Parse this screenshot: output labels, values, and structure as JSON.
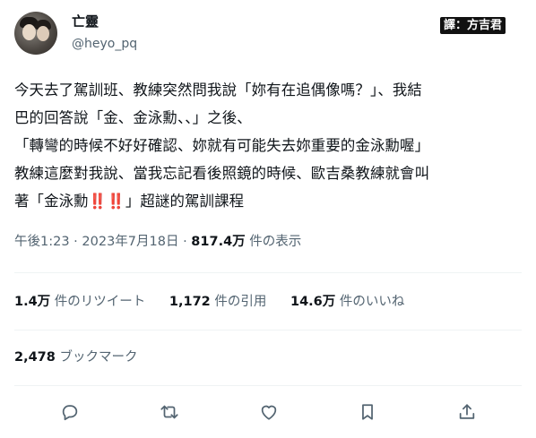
{
  "author": {
    "name": "亡靈",
    "handle": "@heyo_pq"
  },
  "watermark": "譯：方吉君",
  "tweet": {
    "lines": [
      "今天去了駕訓班、教練突然問我說「妳有在追偶像嗎？」、我結",
      "巴的回答說「金、金泳勳、、」之後、",
      "「轉彎的時候不好好確認、妳就有可能失去妳重要的金泳勳喔」",
      "教練這麼對我說、當我忘記看後照鏡的時候、歐吉桑教練就會叫",
      "著「金泳勳‼️‼️」超謎的駕訓課程"
    ]
  },
  "meta": {
    "time": "午後1:23",
    "date": "2023年7月18日",
    "views": "817.4万",
    "views_label": "件の表示"
  },
  "stats": {
    "retweets": "1.4万",
    "retweets_label": "件のリツイート",
    "quotes": "1,172",
    "quotes_label": "件の引用",
    "likes": "14.6万",
    "likes_label": "件のいいね"
  },
  "bookmarks": {
    "count": "2,478",
    "label": "ブックマーク"
  },
  "actions": [
    "reply-icon",
    "retweet-icon",
    "like-icon",
    "bookmark-icon",
    "share-icon"
  ]
}
